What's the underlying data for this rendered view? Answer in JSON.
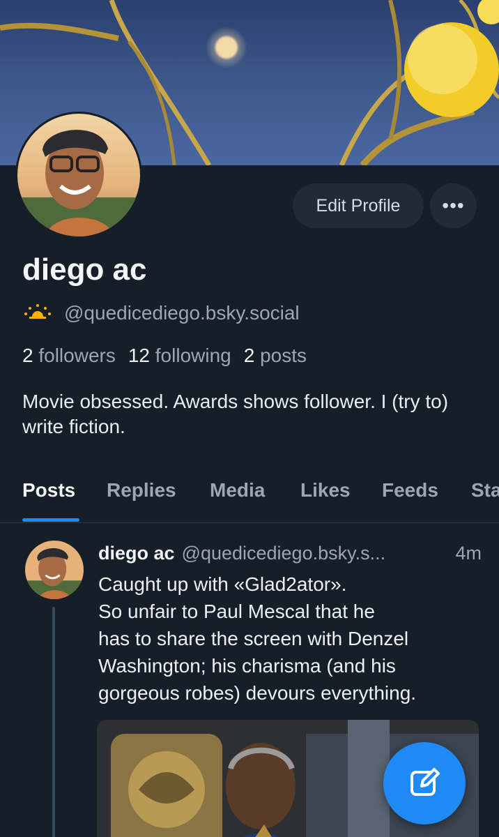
{
  "profile": {
    "display_name": "diego ac",
    "handle": "@quedicediego.bsky.social",
    "bio": "Movie obsessed. Awards shows follower. I (try to) write fiction.",
    "stats": {
      "followers_count": "2",
      "followers_label": "followers",
      "following_count": "12",
      "following_label": "following",
      "posts_count": "2",
      "posts_label": "posts"
    },
    "edit_button_label": "Edit Profile",
    "more_button_label": "•••"
  },
  "tabs": [
    {
      "label": "Posts",
      "active": true
    },
    {
      "label": "Replies"
    },
    {
      "label": "Media"
    },
    {
      "label": "Likes"
    },
    {
      "label": "Feeds"
    },
    {
      "label": "Sta"
    }
  ],
  "post": {
    "author": "diego ac",
    "handle": "@quedicediego.bsky.s...",
    "time": "4m",
    "text": "Caught up with «Glad2ator».\nSo unfair to Paul Mescal that he\nhas to share the screen with Denzel\nWashington; his charisma (and his\ngorgeous robes) devours everything."
  },
  "icons": {
    "handle_badge": "sun-icon",
    "fab": "compose-icon"
  },
  "colors": {
    "background": "#161e27",
    "accent": "#1f8af6",
    "badge": "#f5b301"
  }
}
